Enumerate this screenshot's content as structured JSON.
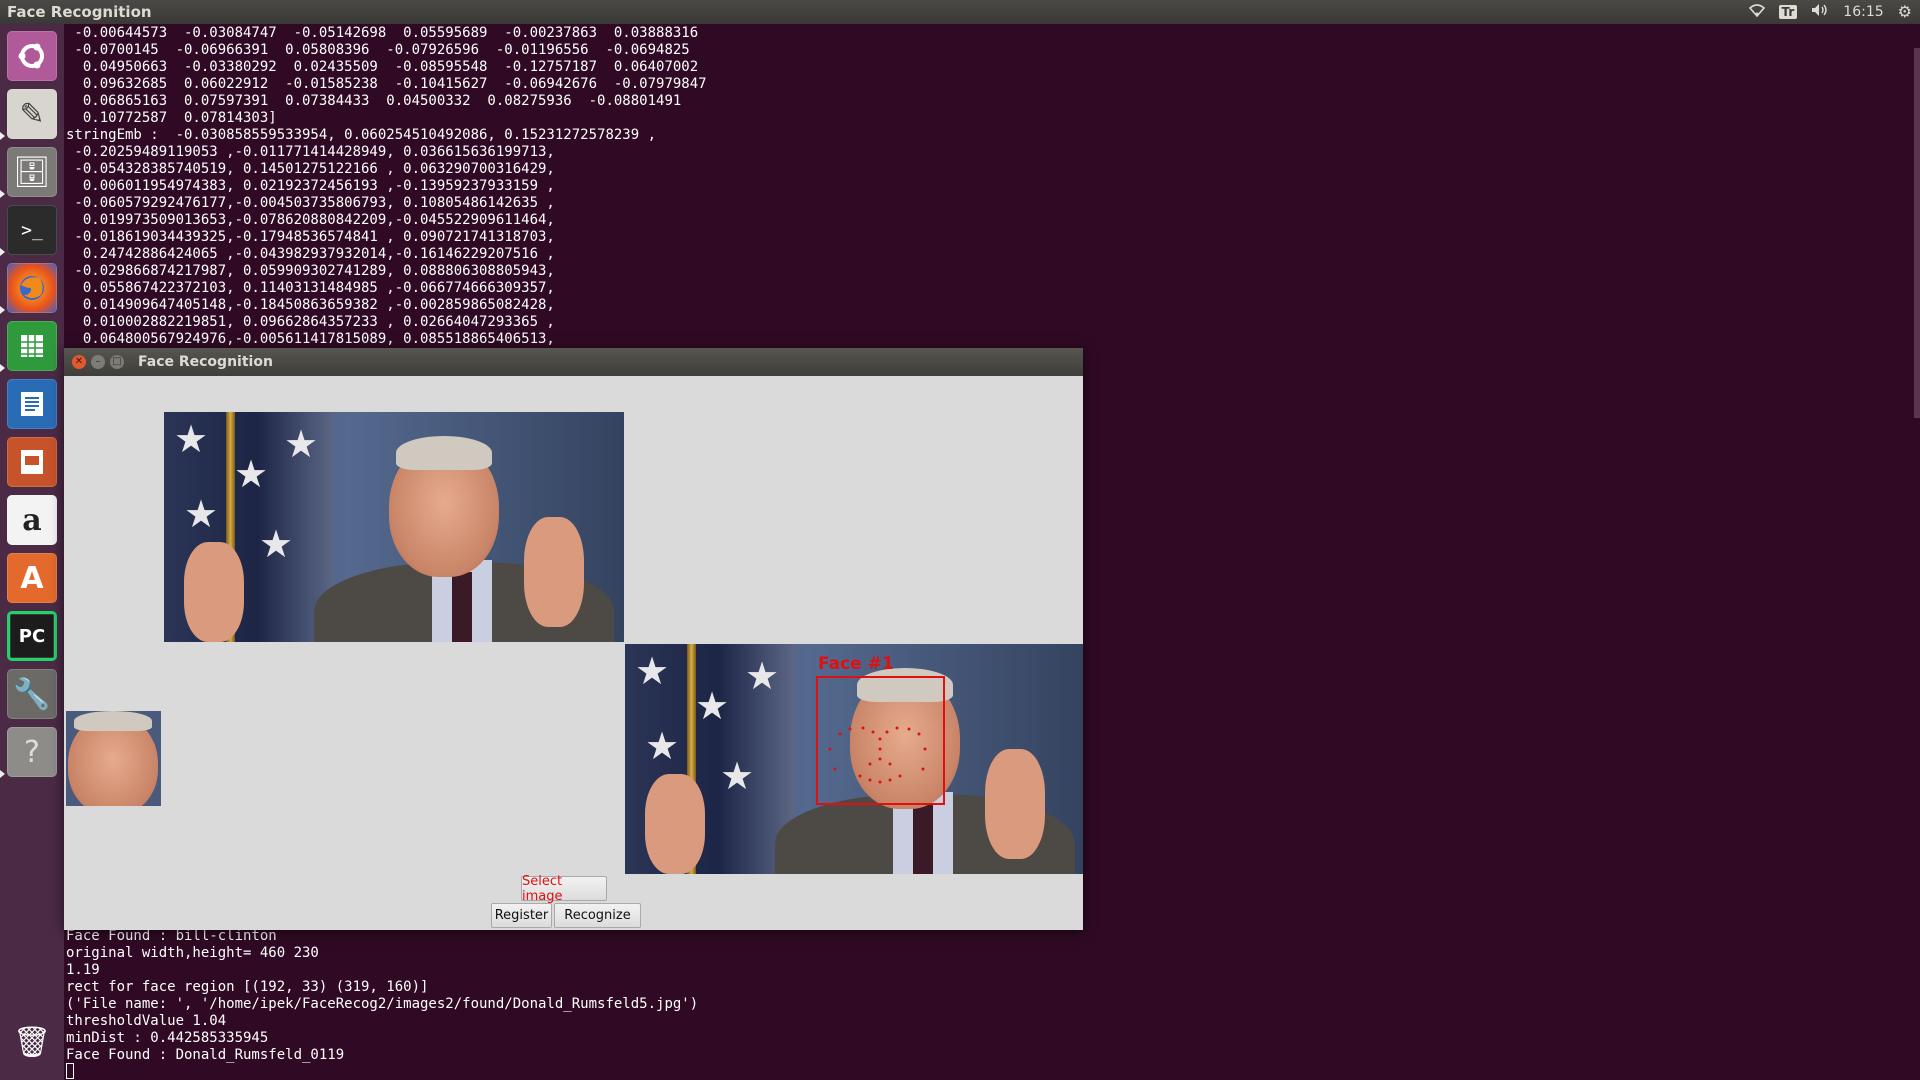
{
  "topbar": {
    "title": "Face Recognition",
    "time": "16:15",
    "keyboard": "Tr"
  },
  "terminal": {
    "lines_top": [
      " -0.00644573  -0.03084747  -0.05142698  0.05595689  -0.00237863  0.03888316",
      " -0.0700145  -0.06966391  0.05808396  -0.07926596  -0.01196556  -0.0694825",
      "  0.04950663  -0.03380292  0.02435509  -0.08595548  -0.12757187  0.06407002",
      "  0.09632685  0.06022912  -0.01585238  -0.10415627  -0.06942676  -0.07979847",
      "  0.06865163  0.07597391  0.07384433  0.04500332  0.08275936  -0.08801491",
      "  0.10772587  0.07814303]",
      "stringEmb :  -0.030858559533954, 0.060254510492086, 0.15231272578239 ,",
      " -0.20259489119053 ,-0.011771414428949, 0.036615636199713,",
      " -0.054328385740519, 0.14501275122166 , 0.063290700316429,",
      "  0.006011954974383, 0.02192372456193 ,-0.13959237933159 ,",
      " -0.060579292476177,-0.004503735806793, 0.10805486142635 ,",
      "  0.019973509013653,-0.078620880842209,-0.045522909611464,",
      " -0.018619034439325,-0.17948536574841 , 0.090721741318703,",
      "  0.24742886424065 ,-0.043982937932014,-0.16146229207516 ,",
      " -0.029866874217987, 0.059909302741289, 0.088806308805943,",
      "  0.055867422372103, 0.11403131484985 ,-0.066774666309357,",
      "  0.014909647405148,-0.18450863659382 ,-0.002859865082428,",
      "  0.010002882219851, 0.09662864357233 , 0.02664047293365 ,",
      "  0.064800567924976,-0.005611417815089, 0.085518865406513,"
    ],
    "lines_bottom": [
      "Face Found : bill-clinton",
      "original width,height= 460 230",
      "1.19",
      "rect for face region [(192, 33) (319, 160)]",
      "('File name: ', '/home/ipek/FaceRecog2/images2/found/Donald_Rumsfeld5.jpg')",
      "thresholdValue 1.04",
      "minDist : 0.442585335945",
      "Face Found : Donald_Rumsfeld_0119"
    ]
  },
  "window": {
    "title": "Face Recognition",
    "face_label": "Face #1",
    "select_image_label": "Select image",
    "register_label": "Register",
    "recognize_label": "Recognize"
  },
  "colors": {
    "accent_red": "#e01010",
    "terminal_bg": "#300a24",
    "launcher_bg": "#4b2a46"
  },
  "launcher": {
    "icons": [
      "ubuntu-dash-icon",
      "text-editor-icon",
      "files-icon",
      "terminal-icon",
      "firefox-icon",
      "calc-icon",
      "writer-icon",
      "impress-icon",
      "amazon-icon",
      "software-center-icon",
      "pycharm-icon",
      "system-settings-icon",
      "help-icon",
      "trash-icon"
    ]
  }
}
